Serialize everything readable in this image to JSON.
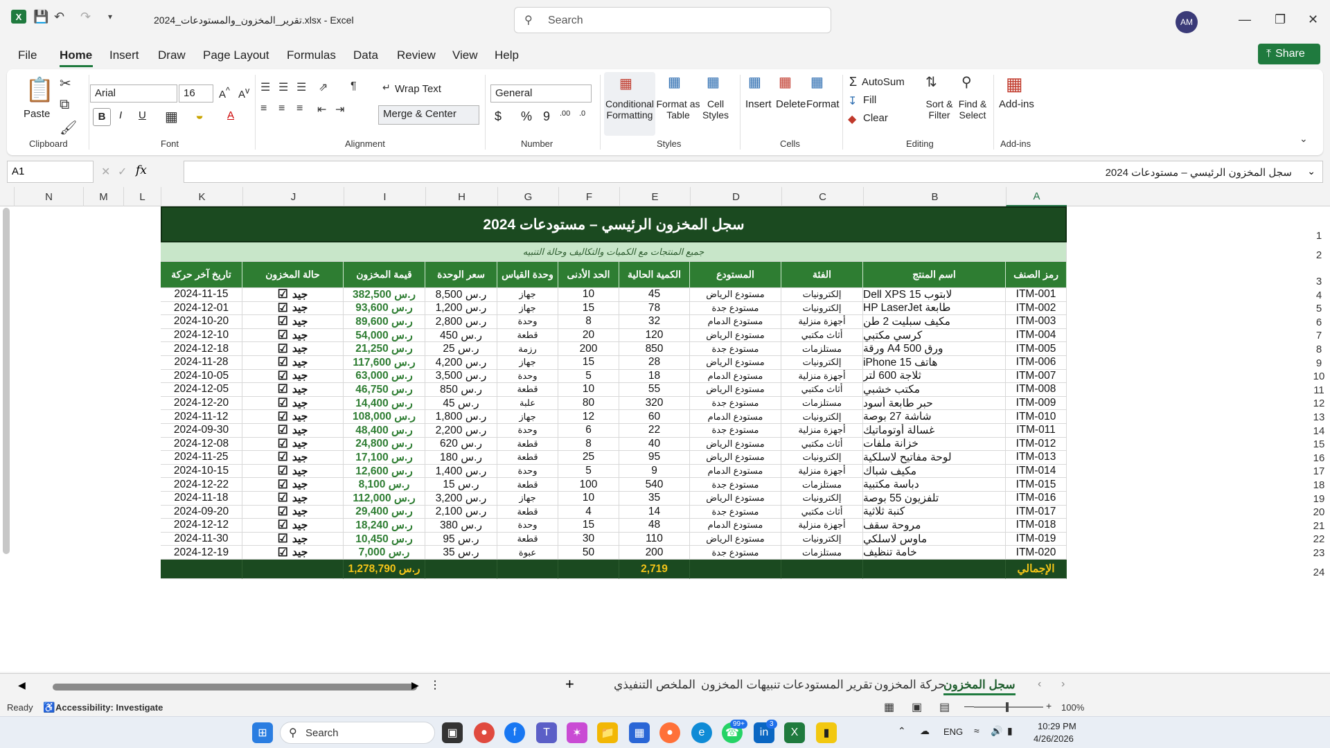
{
  "window": {
    "doc_title": "تقرير_المخزون_والمستودعات_2024.xlsx  -  Excel",
    "search_placeholder": "Search",
    "avatar_initials": "AM"
  },
  "menu": {
    "tabs": [
      "File",
      "Home",
      "Insert",
      "Draw",
      "Page Layout",
      "Formulas",
      "Data",
      "Review",
      "View",
      "Help"
    ],
    "active": "Home",
    "share_label": "Share"
  },
  "ribbon": {
    "clipboard": {
      "paste": "Paste",
      "group": "Clipboard"
    },
    "font": {
      "name": "Arial",
      "size": "16",
      "group": "Font"
    },
    "alignment": {
      "wrap": "Wrap Text",
      "merge": "Merge & Center",
      "group": "Alignment"
    },
    "number": {
      "format": "General",
      "group": "Number"
    },
    "styles": {
      "conditional": "Conditional Formatting",
      "format_table": "Format as Table",
      "cell_styles": "Cell Styles",
      "group": "Styles"
    },
    "cells": {
      "insert": "Insert",
      "delete": "Delete",
      "format": "Format",
      "group": "Cells"
    },
    "editing": {
      "autosum": "AutoSum",
      "fill": "Fill",
      "clear": "Clear",
      "sort": "Sort & Filter",
      "find": "Find & Select",
      "group": "Editing"
    },
    "addins": {
      "label": "Add-ins",
      "group": "Add-ins"
    }
  },
  "formula_bar": {
    "name_box": "A1",
    "fx": "fx",
    "value": "سجل المخزون الرئيسي – مستودعات 2024"
  },
  "columns": [
    "N",
    "M",
    "L",
    "K",
    "J",
    "I",
    "H",
    "G",
    "F",
    "E",
    "D",
    "C",
    "B",
    "A"
  ],
  "rows": [
    "1",
    "2",
    "3",
    "4",
    "5",
    "6",
    "7",
    "8",
    "9",
    "10",
    "11",
    "12",
    "13",
    "14",
    "15",
    "16",
    "17",
    "18",
    "19",
    "20",
    "21",
    "22",
    "23",
    "24"
  ],
  "sheet": {
    "title": "سجل المخزون الرئيسي – مستودعات 2024",
    "subtitle": "جميع المنتجات مع الكميات والتكاليف وحالة التنبيه",
    "headers": {
      "code": "رمز الصنف",
      "name": "اسم المنتج",
      "category": "الفئة",
      "warehouse": "المستودع",
      "qty": "الكمية الحالية",
      "min": "الحد الأدنى",
      "unit": "وحدة القياس",
      "price": "سعر الوحدة",
      "value": "قيمة المخزون",
      "status": "حالة المخزون",
      "date": "تاريخ آخر حركة"
    },
    "rows": [
      {
        "code": "ITM-001",
        "name": "لابتوب Dell XPS 15",
        "category": "إلكترونيات",
        "warehouse": "مستودع الرياض",
        "qty": "45",
        "min": "10",
        "unit": "جهاز",
        "price": "ر.س 8,500",
        "value": "ر.س 382,500",
        "status": "جيد",
        "date": "2024-11-15"
      },
      {
        "code": "ITM-002",
        "name": "طابعة HP LaserJet",
        "category": "إلكترونيات",
        "warehouse": "مستودع جدة",
        "qty": "78",
        "min": "15",
        "unit": "جهاز",
        "price": "ر.س 1,200",
        "value": "ر.س 93,600",
        "status": "جيد",
        "date": "2024-12-01"
      },
      {
        "code": "ITM-003",
        "name": "مكيف سبليت 2 طن",
        "category": "أجهزة منزلية",
        "warehouse": "مستودع الدمام",
        "qty": "32",
        "min": "8",
        "unit": "وحدة",
        "price": "ر.س 2,800",
        "value": "ر.س 89,600",
        "status": "جيد",
        "date": "2024-10-20"
      },
      {
        "code": "ITM-004",
        "name": "كرسي مكتبي",
        "category": "أثاث مكتبي",
        "warehouse": "مستودع الرياض",
        "qty": "120",
        "min": "20",
        "unit": "قطعة",
        "price": "ر.س 450",
        "value": "ر.س 54,000",
        "status": "جيد",
        "date": "2024-12-10"
      },
      {
        "code": "ITM-005",
        "name": "ورق A4 500 ورقة",
        "category": "مستلزمات",
        "warehouse": "مستودع جدة",
        "qty": "850",
        "min": "200",
        "unit": "رزمة",
        "price": "ر.س 25",
        "value": "ر.س 21,250",
        "status": "جيد",
        "date": "2024-12-18"
      },
      {
        "code": "ITM-006",
        "name": "هاتف iPhone 15",
        "category": "إلكترونيات",
        "warehouse": "مستودع الرياض",
        "qty": "28",
        "min": "15",
        "unit": "جهاز",
        "price": "ر.س 4,200",
        "value": "ر.س 117,600",
        "status": "جيد",
        "date": "2024-11-28"
      },
      {
        "code": "ITM-007",
        "name": "ثلاجة 600 لتر",
        "category": "أجهزة منزلية",
        "warehouse": "مستودع الدمام",
        "qty": "18",
        "min": "5",
        "unit": "وحدة",
        "price": "ر.س 3,500",
        "value": "ر.س 63,000",
        "status": "جيد",
        "date": "2024-10-05"
      },
      {
        "code": "ITM-008",
        "name": "مكتب خشبي",
        "category": "أثاث مكتبي",
        "warehouse": "مستودع الرياض",
        "qty": "55",
        "min": "10",
        "unit": "قطعة",
        "price": "ر.س 850",
        "value": "ر.س 46,750",
        "status": "جيد",
        "date": "2024-12-05"
      },
      {
        "code": "ITM-009",
        "name": "حبر طابعة أسود",
        "category": "مستلزمات",
        "warehouse": "مستودع جدة",
        "qty": "320",
        "min": "80",
        "unit": "علبة",
        "price": "ر.س 45",
        "value": "ر.س 14,400",
        "status": "جيد",
        "date": "2024-12-20"
      },
      {
        "code": "ITM-010",
        "name": "شاشة 27 بوصة",
        "category": "إلكترونيات",
        "warehouse": "مستودع الدمام",
        "qty": "60",
        "min": "12",
        "unit": "جهاز",
        "price": "ر.س 1,800",
        "value": "ر.س 108,000",
        "status": "جيد",
        "date": "2024-11-12"
      },
      {
        "code": "ITM-011",
        "name": "غسالة أوتوماتيك",
        "category": "أجهزة منزلية",
        "warehouse": "مستودع جدة",
        "qty": "22",
        "min": "6",
        "unit": "وحدة",
        "price": "ر.س 2,200",
        "value": "ر.س 48,400",
        "status": "جيد",
        "date": "2024-09-30"
      },
      {
        "code": "ITM-012",
        "name": "خزانة ملفات",
        "category": "أثاث مكتبي",
        "warehouse": "مستودع الرياض",
        "qty": "40",
        "min": "8",
        "unit": "قطعة",
        "price": "ر.س 620",
        "value": "ر.س 24,800",
        "status": "جيد",
        "date": "2024-12-08"
      },
      {
        "code": "ITM-013",
        "name": "لوحة مفاتيح لاسلكية",
        "category": "إلكترونيات",
        "warehouse": "مستودع الرياض",
        "qty": "95",
        "min": "25",
        "unit": "قطعة",
        "price": "ر.س 180",
        "value": "ر.س 17,100",
        "status": "جيد",
        "date": "2024-11-25"
      },
      {
        "code": "ITM-014",
        "name": "مكيف شباك",
        "category": "أجهزة منزلية",
        "warehouse": "مستودع الدمام",
        "qty": "9",
        "min": "5",
        "unit": "وحدة",
        "price": "ر.س 1,400",
        "value": "ر.س 12,600",
        "status": "جيد",
        "date": "2024-10-15"
      },
      {
        "code": "ITM-015",
        "name": "دباسة مكتبية",
        "category": "مستلزمات",
        "warehouse": "مستودع جدة",
        "qty": "540",
        "min": "100",
        "unit": "قطعة",
        "price": "ر.س 15",
        "value": "ر.س 8,100",
        "status": "جيد",
        "date": "2024-12-22"
      },
      {
        "code": "ITM-016",
        "name": "تلفزيون 55 بوصة",
        "category": "إلكترونيات",
        "warehouse": "مستودع الرياض",
        "qty": "35",
        "min": "10",
        "unit": "جهاز",
        "price": "ر.س 3,200",
        "value": "ر.س 112,000",
        "status": "جيد",
        "date": "2024-11-18"
      },
      {
        "code": "ITM-017",
        "name": "كنبة ثلاثية",
        "category": "أثاث مكتبي",
        "warehouse": "مستودع جدة",
        "qty": "14",
        "min": "4",
        "unit": "قطعة",
        "price": "ر.س 2,100",
        "value": "ر.س 29,400",
        "status": "جيد",
        "date": "2024-09-20"
      },
      {
        "code": "ITM-018",
        "name": "مروحة سقف",
        "category": "أجهزة منزلية",
        "warehouse": "مستودع الدمام",
        "qty": "48",
        "min": "15",
        "unit": "وحدة",
        "price": "ر.س 380",
        "value": "ر.س 18,240",
        "status": "جيد",
        "date": "2024-12-12"
      },
      {
        "code": "ITM-019",
        "name": "ماوس لاسلكي",
        "category": "إلكترونيات",
        "warehouse": "مستودع الرياض",
        "qty": "110",
        "min": "30",
        "unit": "قطعة",
        "price": "ر.س 95",
        "value": "ر.س 10,450",
        "status": "جيد",
        "date": "2024-11-30"
      },
      {
        "code": "ITM-020",
        "name": "خامة تنظيف",
        "category": "مستلزمات",
        "warehouse": "مستودع جدة",
        "qty": "200",
        "min": "50",
        "unit": "عبوة",
        "price": "ر.س 35",
        "value": "ر.س 7,000",
        "status": "جيد",
        "date": "2024-12-19"
      }
    ],
    "total_label": "الإجمالي",
    "total_qty": "2,719",
    "total_value": "ر.س 1,278,790"
  },
  "sheet_tabs": [
    "سجل المخزون",
    "حركة المخزون",
    "تقرير المستودعات",
    "تنبيهات المخزون",
    "الملخص التنفيذي"
  ],
  "active_sheet": "سجل المخزون",
  "status": {
    "ready": "Ready",
    "accessibility": "Accessibility: Investigate",
    "zoom": "100%"
  },
  "taskbar": {
    "search": "Search",
    "lang": "ENG",
    "time": "10:29 PM",
    "date": "4/26/2026",
    "whatsapp_badge": "99+",
    "linkedin_badge": "3"
  },
  "colors": {
    "header_dark": "#1b4a20",
    "header_green": "#2e7d32",
    "subtitle_bg": "#c8e6c9",
    "total_bg": "#1b4a20",
    "gold": "#f5c518"
  }
}
